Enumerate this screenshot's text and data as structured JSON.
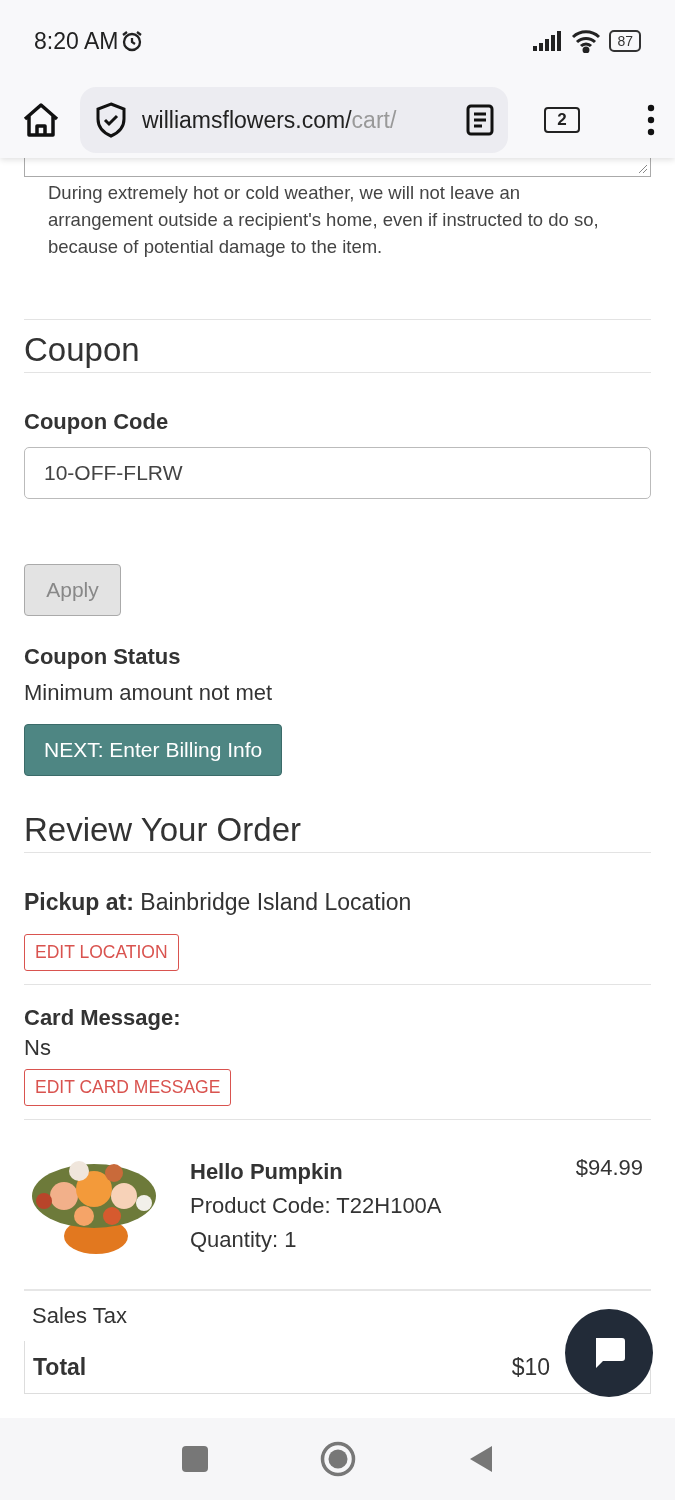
{
  "status_bar": {
    "time": "8:20 AM",
    "battery": "87"
  },
  "browser": {
    "url_main": "williamsflowers.com/",
    "url_faded": "cart/",
    "tab_count": "2"
  },
  "delivery_note": "During extremely hot or cold weather, we will not leave an arrangement outside a recipient's home, even if instructed to do so, because of potential damage to the item.",
  "coupon": {
    "heading": "Coupon",
    "label": "Coupon Code",
    "value": "10-OFF-FLRW",
    "apply_button": "Apply",
    "apply_disabled": true,
    "status_label": "Coupon Status",
    "status_text": "Minimum amount not met",
    "next_button": "NEXT: Enter Billing Info"
  },
  "review": {
    "heading": "Review Your Order",
    "pickup_label": "Pickup at:",
    "pickup_value": "Bainbridge Island Location",
    "edit_location": "EDIT LOCATION",
    "card_label": "Card Message:",
    "card_value": "Ns",
    "edit_card": "EDIT CARD MESSAGE",
    "items": [
      {
        "kind": "picture",
        "name": "Hello Pumpkin",
        "code": "Product Code: T22H100A",
        "quantity": "Quantity: 1",
        "price": "$94.99"
      }
    ],
    "totals": [
      {
        "label": "Sales Tax",
        "bold": false
      },
      {
        "label": "Total",
        "value": "$10",
        "bold": true
      }
    ]
  }
}
